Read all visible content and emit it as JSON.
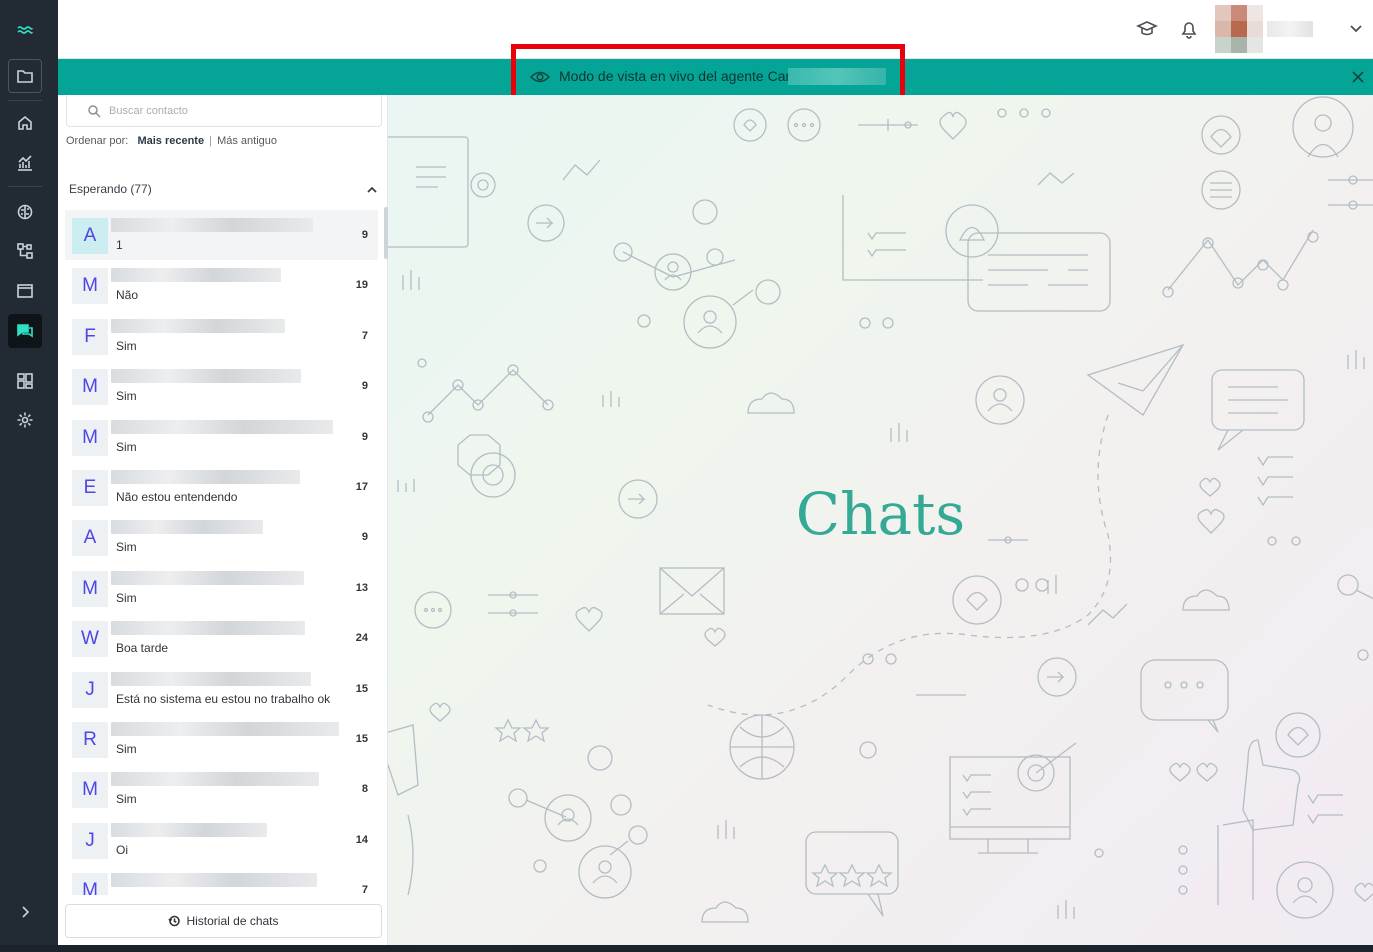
{
  "app": {
    "rail": {
      "icons": [
        "waves-logo-icon",
        "folder-icon",
        "home-icon",
        "analytics-icon",
        "brain-icon",
        "flow-icon",
        "window-icon",
        "chat-icon",
        "dashboard-icon",
        "settings-icon",
        "chevron-right-icon"
      ]
    },
    "banner": {
      "text": "Modo de vista en vivo del agente Car"
    },
    "search": {
      "placeholder": "Buscar contacto"
    },
    "sort": {
      "label": "Ordenar por:",
      "option_recent": "Mais recente",
      "separator": "|",
      "option_oldest": "Más antiguo"
    },
    "waiting": {
      "title": "Esperando (77)"
    },
    "contacts": [
      {
        "letter": "A",
        "message": "1",
        "count": "9"
      },
      {
        "letter": "M",
        "message": "Não",
        "count": "19"
      },
      {
        "letter": "F",
        "message": "Sim",
        "count": "7"
      },
      {
        "letter": "M",
        "message": "Sim",
        "count": "9"
      },
      {
        "letter": "M",
        "message": "Sim",
        "count": "9"
      },
      {
        "letter": "E",
        "message": "Não estou entendendo",
        "count": "17"
      },
      {
        "letter": "A",
        "message": "Sim",
        "count": "9"
      },
      {
        "letter": "M",
        "message": "Sim",
        "count": "13"
      },
      {
        "letter": "W",
        "message": "Boa tarde",
        "count": "24"
      },
      {
        "letter": "J",
        "message": "Está no sistema eu estou no trabalho ok",
        "count": "15"
      },
      {
        "letter": "R",
        "message": "Sim",
        "count": "15"
      },
      {
        "letter": "M",
        "message": "Sim",
        "count": "8"
      },
      {
        "letter": "J",
        "message": "Oi",
        "count": "14"
      },
      {
        "letter": "M",
        "message": "",
        "count": "7"
      }
    ],
    "history_button": "Historial de chats",
    "main": {
      "title": "Chats"
    },
    "colors": {
      "rail_bg": "#222a33",
      "accent": "#04a596",
      "title_color": "#34a996",
      "avatar_letter": "#4f46e5",
      "highlight_border": "#e8000a"
    }
  }
}
